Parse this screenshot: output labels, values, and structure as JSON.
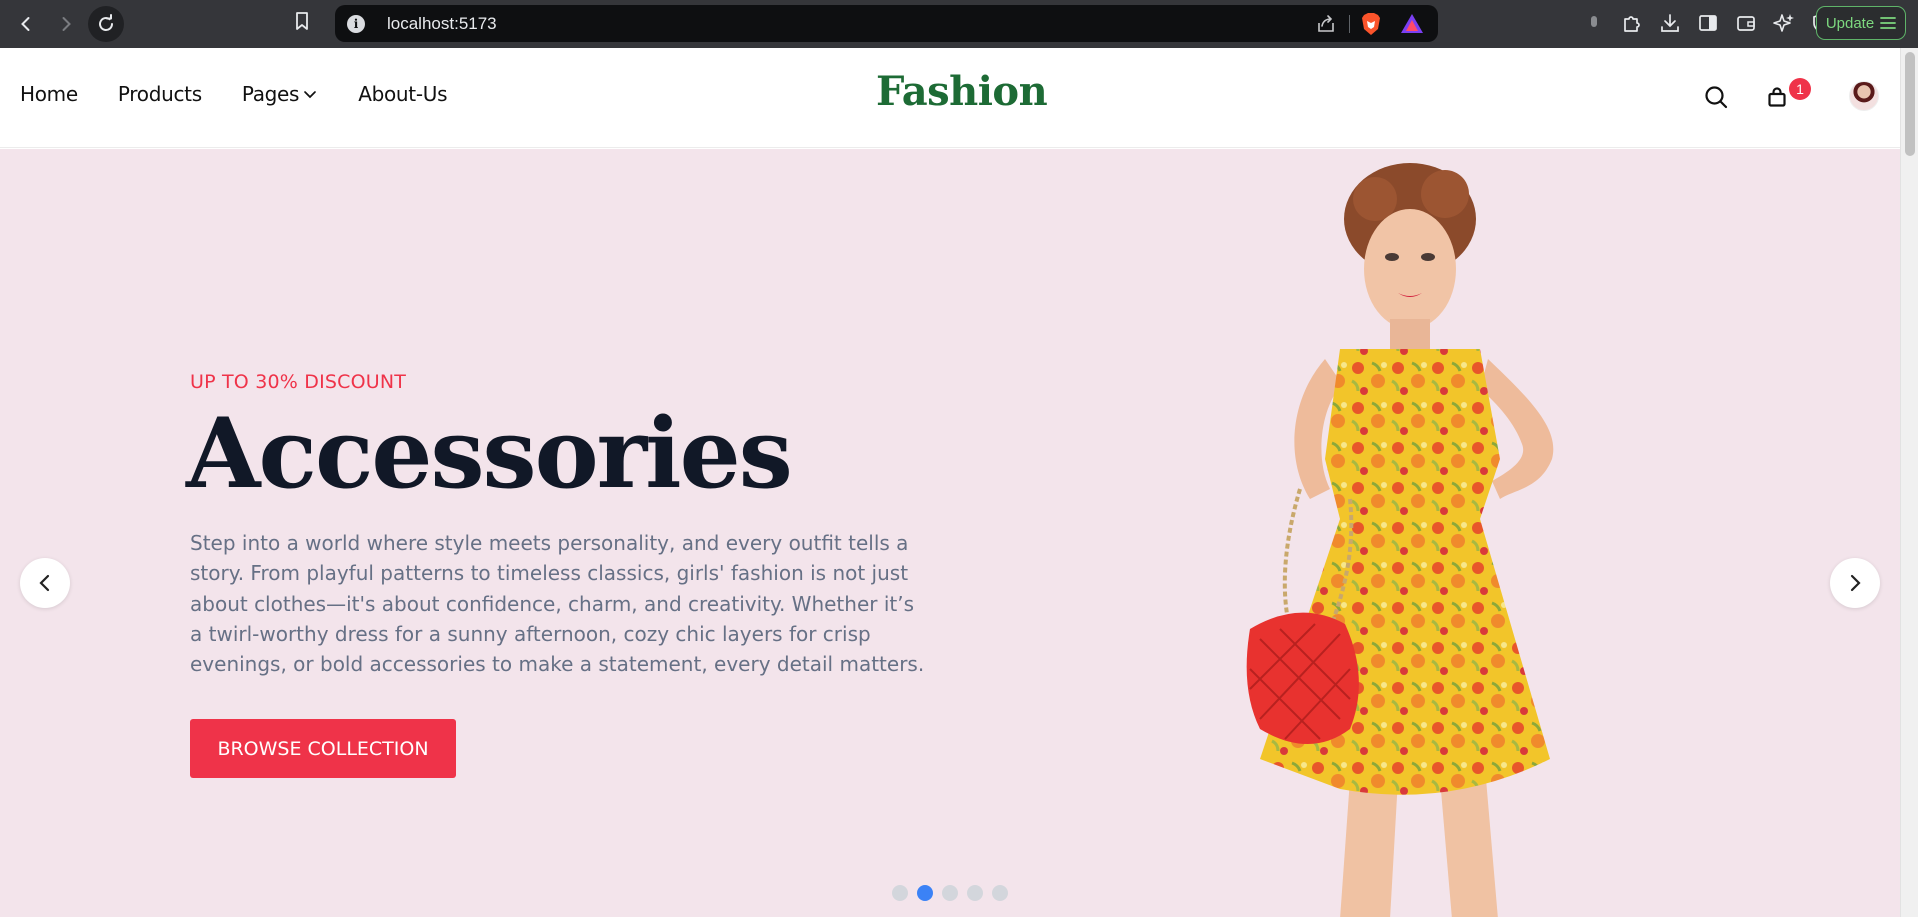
{
  "browser": {
    "url": "localhost:5173",
    "update_label": "Update"
  },
  "header": {
    "nav": [
      {
        "label": "Home"
      },
      {
        "label": "Products"
      },
      {
        "label": "Pages"
      },
      {
        "label": "About-Us"
      }
    ],
    "logo": "Fashion",
    "cart_count": "1"
  },
  "hero": {
    "eyebrow": "UP TO 30% DISCOUNT",
    "title": "Accessories",
    "description": "Step into a world where style meets personality, and every outfit tells a story. From playful patterns to timeless classics, girls' fashion is not just about clothes—it's about confidence, charm, and creativity. Whether it’s a twirl-worthy dress for a sunny afternoon, cozy chic layers for crisp evenings, or bold accessories to make a statement, every detail matters.",
    "button_label": "BROWSE COLLECTION",
    "slides_total": 5,
    "active_slide": 2
  },
  "colors": {
    "accent": "#ef3349",
    "logo": "#1d6b35",
    "hero_bg": "#f3e4eb",
    "active_dot": "#3b82f6"
  },
  "icons": [
    "back-icon",
    "forward-icon",
    "reload-icon",
    "bookmark-icon",
    "info-icon",
    "share-icon",
    "brave-shield-icon",
    "brave-rewards-icon",
    "search-icon",
    "cart-icon",
    "chevron-down-icon",
    "chevron-left-icon",
    "chevron-right-icon"
  ]
}
